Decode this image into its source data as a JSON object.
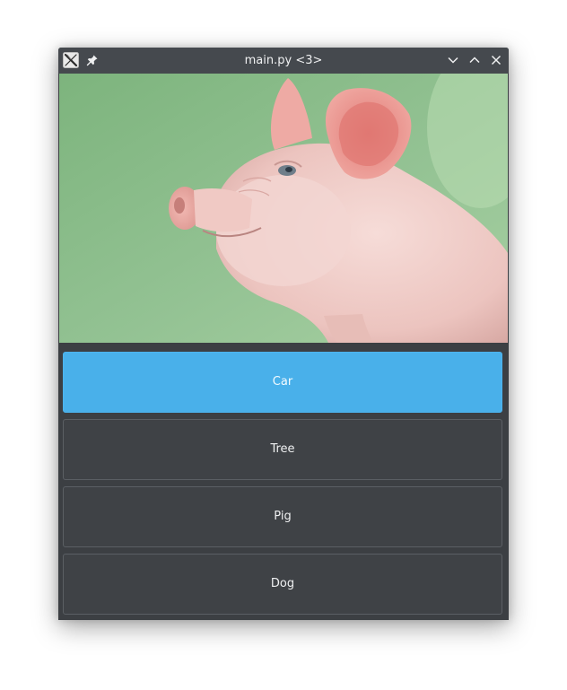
{
  "window": {
    "title": "main.py <3>",
    "app_icon": "x-app-icon",
    "controls": {
      "pin": "pin-icon",
      "minimize": "chevron-down-icon",
      "maximize": "chevron-up-icon",
      "close": "close-icon"
    }
  },
  "image": {
    "subject_icon": "pig-photo"
  },
  "choices": [
    {
      "label": "Car",
      "selected": true
    },
    {
      "label": "Tree",
      "selected": false
    },
    {
      "label": "Pig",
      "selected": false
    },
    {
      "label": "Dog",
      "selected": false
    }
  ],
  "colors": {
    "titlebar": "#45494e",
    "window_bg": "#3c3f43",
    "button_bg": "#3f4246",
    "button_border": "#5b5f64",
    "selected_button": "#49b0ea",
    "text": "#eff0f1",
    "photo_background": "#86b886"
  }
}
